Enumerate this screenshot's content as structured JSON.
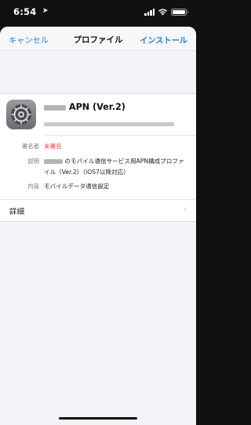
{
  "status_bar": {
    "time": "6:54",
    "location_glyph": "➤"
  },
  "nav": {
    "cancel_label": "キャンセル",
    "title": "プロファイル",
    "install_label": "インストール"
  },
  "profile": {
    "name_suffix": "APN (Ver.2)",
    "icon": "settings-gear-icon"
  },
  "details": {
    "signer": {
      "label": "署名者",
      "value": "未署名"
    },
    "description": {
      "label": "説明",
      "value": "のモバイル通信サービス用APN構成プロファイル（Ver.2）（iOS7以降対応）"
    },
    "contents": {
      "label": "内容",
      "value": "モバイルデータ通信設定"
    }
  },
  "more": {
    "label": "詳細",
    "chevron": "›"
  },
  "colors": {
    "accent": "#147efb",
    "unsigned": "#ff3b30",
    "background": "#f2f2f7"
  }
}
